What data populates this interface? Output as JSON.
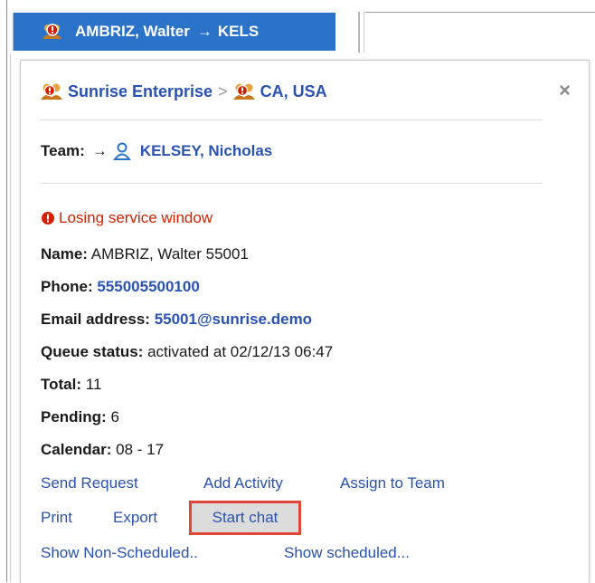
{
  "tab": {
    "name": "AMBRIZ, Walter",
    "arrow": "→",
    "target": "KELS"
  },
  "breadcrumb": {
    "org": "Sunrise Enterprise",
    "separator": ">",
    "location": "CA, USA"
  },
  "close_glyph": "×",
  "team": {
    "label": "Team:",
    "arrow": "→",
    "member": "KELSEY, Nicholas"
  },
  "alert": "Losing service window",
  "details": {
    "name_label": "Name:",
    "name_value": "AMBRIZ, Walter 55001",
    "phone_label": "Phone:",
    "phone_value": "555005500100",
    "email_label": "Email address:",
    "email_value": "55001@sunrise.demo",
    "queue_label": "Queue status:",
    "queue_value": "activated at 02/12/13 06:47",
    "total_label": "Total:",
    "total_value": "11",
    "pending_label": "Pending:",
    "pending_value": "6",
    "calendar_label": "Calendar:",
    "calendar_value": "08 - 17"
  },
  "actions": {
    "send_request": "Send Request",
    "add_activity": "Add Activity",
    "assign_team": "Assign to Team",
    "print": "Print",
    "export": "Export",
    "start_chat": "Start chat",
    "show_non_scheduled": "Show Non-Scheduled..",
    "show_scheduled": "Show scheduled..."
  },
  "colors": {
    "tab_bg": "#2a73c9",
    "link": "#2a52b0",
    "alert": "#d62000",
    "highlight_border": "#e0473a"
  },
  "icons": {
    "tab_icon": "group-alert-icon",
    "org_icon": "group-alert-icon",
    "location_icon": "group-alert-icon",
    "team_icon": "person-icon",
    "alert_icon": "alert-icon"
  }
}
